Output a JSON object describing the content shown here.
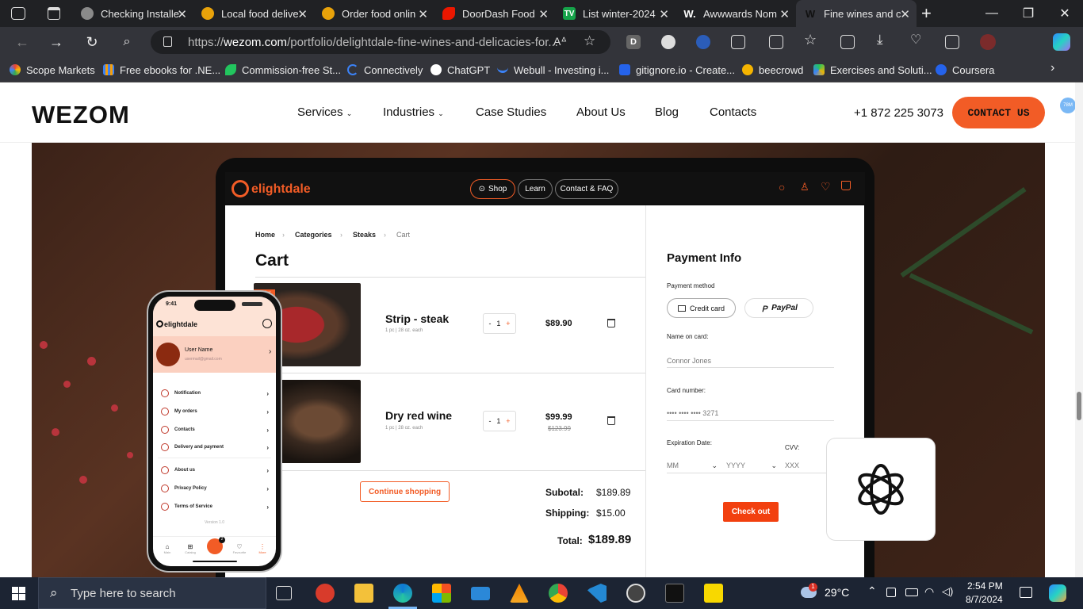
{
  "browser": {
    "tabs": [
      {
        "title": "Checking Installe",
        "icon_color": "#8a8a8a"
      },
      {
        "title": "Local food delive",
        "icon_color": "#e8a20a"
      },
      {
        "title": "Order food onlin",
        "icon_color": "#e8a20a"
      },
      {
        "title": "DoorDash Food",
        "icon_color": "#eb1700"
      },
      {
        "title": "List winter-2024",
        "icon_color": "#16a34a"
      },
      {
        "title": "Awwwards Nom",
        "icon_color": "#222222"
      },
      {
        "title": "Fine wines and c",
        "icon_color": "#222222"
      }
    ],
    "url_prefix": "https://",
    "url_domain": "wezom.com",
    "url_path": "/portfolio/delightdale-fine-wines-and-delicacies-for...",
    "bookmarks": [
      "Scope Markets",
      "Free ebooks for .NE...",
      "Commission-free St...",
      "Connectively",
      "ChatGPT",
      "Webull - Investing i...",
      "gitignore.io - Create...",
      "beecrowd",
      "Exercises and Soluti...",
      "Coursera"
    ]
  },
  "site": {
    "logo": "WEZOM",
    "nav": [
      "Services",
      "Industries",
      "Case Studies",
      "About Us",
      "Blog",
      "Contacts"
    ],
    "phone": "+1 872 225 3073",
    "cta": "CONTACT US",
    "badge": "78M"
  },
  "laptop": {
    "brand": "elightdale",
    "pills": [
      "Shop",
      "Learn",
      "Contact & FAQ"
    ],
    "breadcrumbs": [
      "Home",
      "Categories",
      "Steaks",
      "Cart"
    ],
    "title": "Cart",
    "items": [
      {
        "name": "Strip - steak",
        "meta": "1 pc | 28 oz. each",
        "qty": "1",
        "price": "$89.90",
        "old": ""
      },
      {
        "name": "Dry red wine",
        "meta": "1 pc | 28 oz. each",
        "qty": "1",
        "price": "$99.99",
        "old": "$123.99"
      }
    ],
    "badge_text": "Seller",
    "continue": "Continue shopping",
    "subtotal_label": "Subotal:",
    "subtotal": "$189.89",
    "shipping_label": "Shipping:",
    "shipping": "$15.00",
    "total_label": "Total:",
    "total": "$189.89",
    "payment": {
      "title": "Payment Info",
      "method_label": "Payment method",
      "credit": "Credit card",
      "paypal": "PayPal",
      "name_label": "Name on card:",
      "name_value": "Connor Jones",
      "card_label": "Card number:",
      "card_value": "•••• •••• ••••  3271",
      "exp_label": "Expiration Date:",
      "cvv_label": "CVV:",
      "mm": "MM",
      "yyyy": "YYYY",
      "cvv": "XXX",
      "checkout": "Check out"
    }
  },
  "phone_app": {
    "time": "9:41",
    "brand": "elightdale",
    "user_name": "User Name",
    "user_email": "usermail@gmail.com",
    "menu": [
      "Notification",
      "My orders",
      "Contacts",
      "Delivery and payment",
      "About us",
      "Privacy Policy",
      "Terms of Service"
    ],
    "version": "Version 1.0",
    "tabs": [
      "Main",
      "Catalog",
      "",
      "Favourite",
      "More"
    ],
    "cart_count": "2"
  },
  "taskbar": {
    "search_placeholder": "Type here to search",
    "weather": "29°C",
    "weather_badge": "1",
    "time": "2:54 PM",
    "date": "8/7/2024"
  }
}
